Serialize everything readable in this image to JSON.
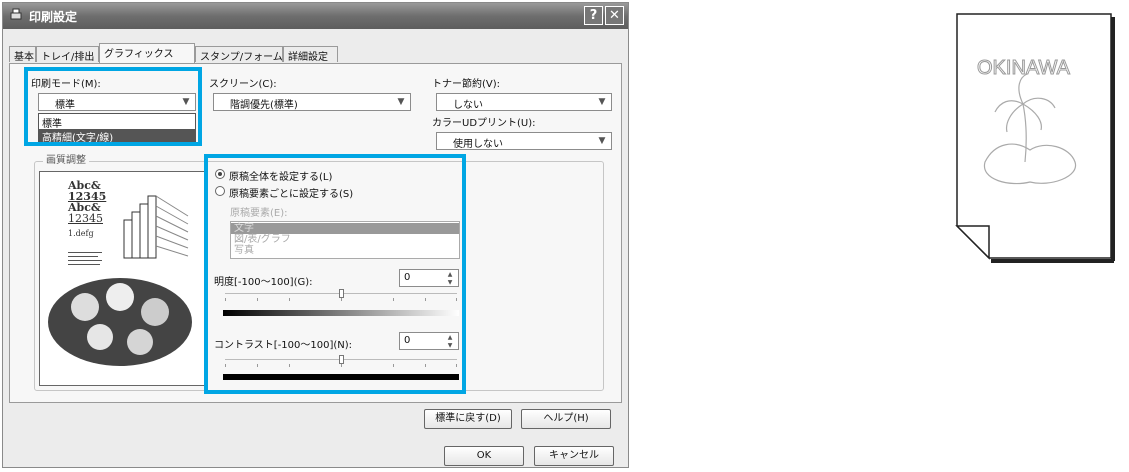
{
  "window": {
    "title": "印刷設定",
    "help_button": "?",
    "close_button": "✕"
  },
  "tabs": [
    {
      "label": "基本"
    },
    {
      "label": "トレイ/排出"
    },
    {
      "label": "グラフィックス",
      "active": true
    },
    {
      "label": "スタンプ/フォーム"
    },
    {
      "label": "詳細設定"
    }
  ],
  "print_mode": {
    "label": "印刷モード(M):",
    "value": "標準",
    "options": [
      "標準",
      "高精細(文字/線)"
    ],
    "selected_option": "高精細(文字/線)"
  },
  "screen": {
    "label": "スクリーン(C):",
    "value": "階調優先(標準)"
  },
  "toner_save": {
    "label": "トナー節約(V):",
    "value": "しない"
  },
  "color_ud": {
    "label": "カラーUDプリント(U):",
    "value": "使用しない"
  },
  "quality": {
    "group_label": "画質調整",
    "radio_all": "原稿全体を設定する(L)",
    "radio_each": "原稿要素ごとに設定する(S)",
    "radio_selected": "all",
    "element_label": "原稿要素(E):",
    "elements": [
      "文字",
      "図/表/グラフ",
      "写真"
    ],
    "brightness": {
      "label": "明度[-100～100](G):",
      "value": "0"
    },
    "contrast": {
      "label": "コントラスト[-100～100](N):",
      "value": "0"
    }
  },
  "preview_text": {
    "l1": "Abc&",
    "l2": "12345",
    "l3": "Abc&",
    "l4": "12345",
    "l5": "1.defg"
  },
  "buttons": {
    "reset": "標準に戻す(D)",
    "help": "ヘルプ(H)",
    "ok": "OK",
    "cancel": "キャンセル"
  },
  "sample_page": {
    "text": "OKINAWA"
  },
  "colors": {
    "highlight": "#00a6e4",
    "titlebar": "#6e6e6e"
  }
}
